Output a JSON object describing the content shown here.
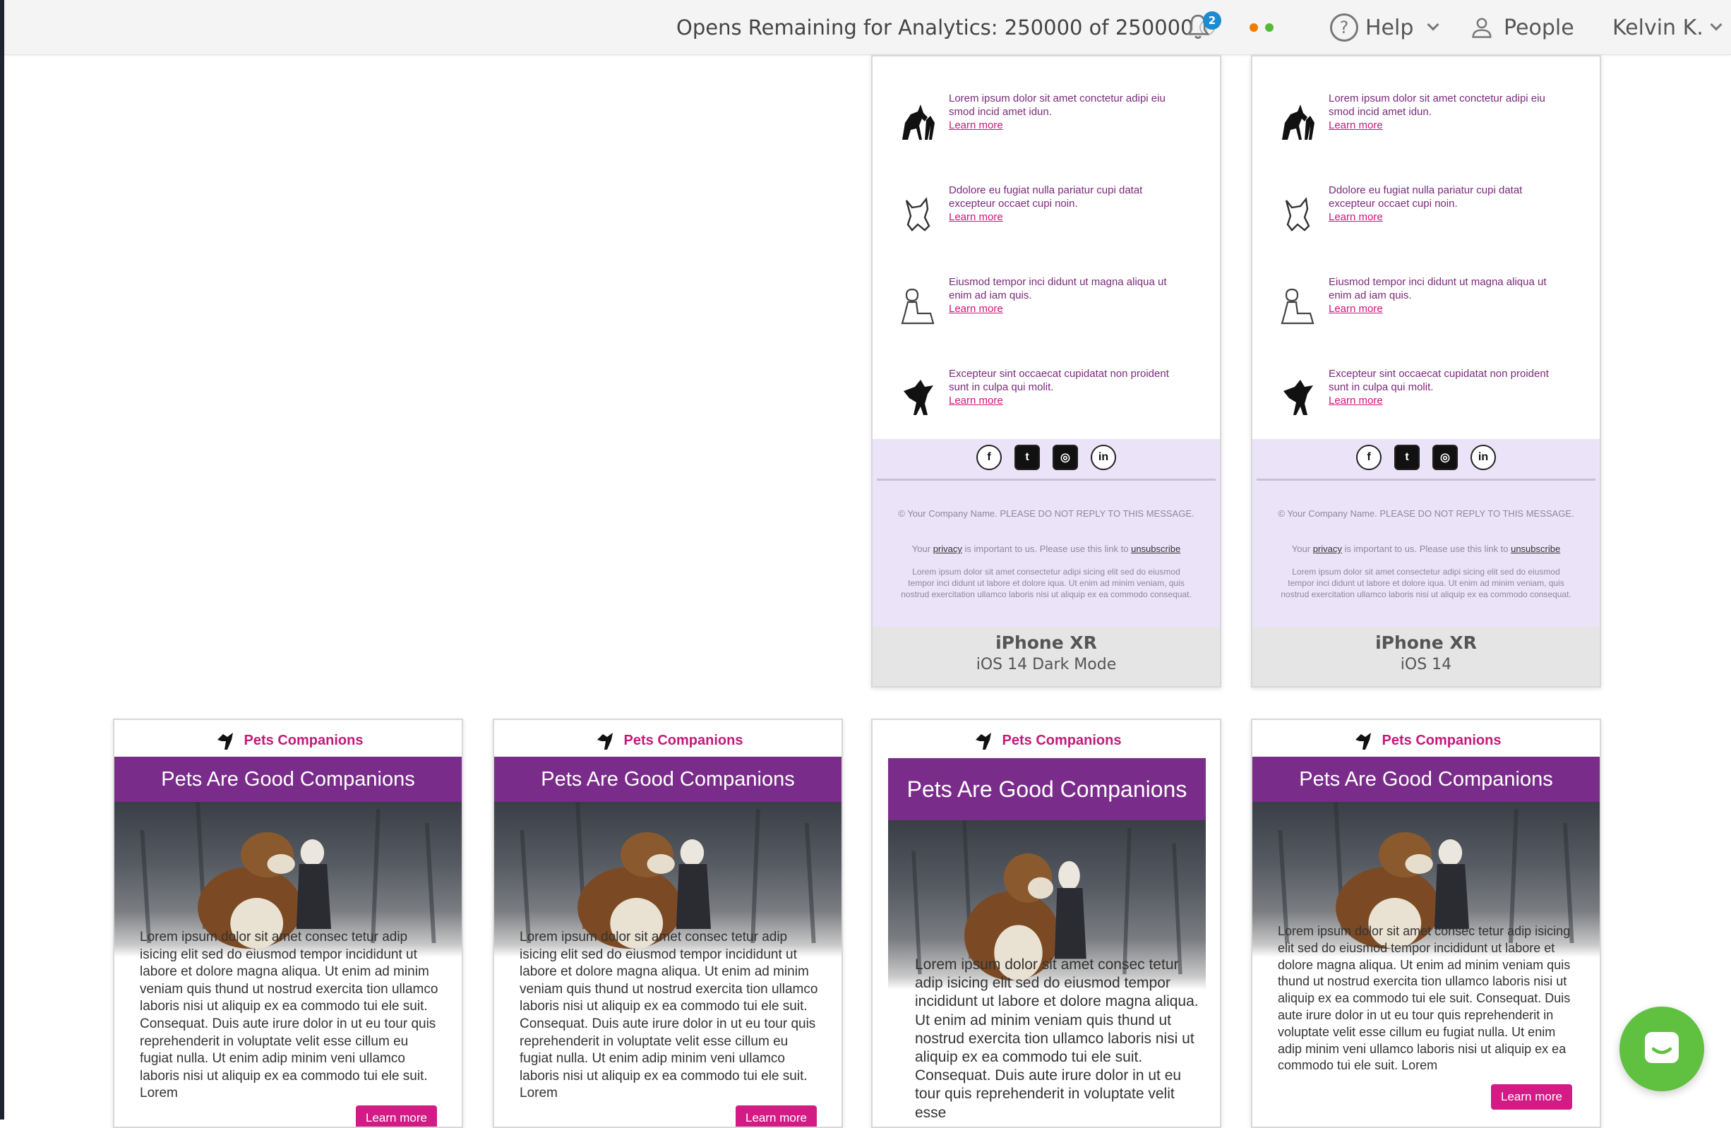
{
  "topbar": {
    "opens_text": "Opens Remaining for Analytics: 250000 of 250000",
    "notification_count": "2",
    "help_label": "Help",
    "people_label": "People",
    "user_label": "Kelvin K.",
    "status_dot_colors": [
      "#f07c00",
      "#55b83a"
    ]
  },
  "top_cards": [
    {
      "features": [
        {
          "icon": "horse-rider-icon",
          "text": "Lorem ipsum dolor sit amet conctetur adipi eiu smod incid amet idun.",
          "link": "Learn more"
        },
        {
          "icon": "cat-icon",
          "text": "Ddolore eu fugiat nulla pariatur cupi datat excepteur occaet cupi noin.",
          "link": "Learn more"
        },
        {
          "icon": "person-dog-icon",
          "text": "Eiusmod tempor inci didunt ut magna aliqua ut enim ad iam quis.",
          "link": "Learn more"
        },
        {
          "icon": "bird-icon",
          "text": "Excepteur sint occaecat cupidatat non proident sunt in culpa qui molit.",
          "link": "Learn more"
        }
      ],
      "copyright": "© Your Company Name. PLEASE DO NOT REPLY TO THIS MESSAGE.",
      "privacy_prefix": "Your",
      "privacy_link": "privacy",
      "privacy_middle": "is important to us. Please use this link to",
      "unsubscribe_link": "unsubscribe",
      "fine_print": "Lorem ipsum dolor sit amet consectetur adipi sicing elit sed do eiusmod tempor inci didunt ut labore et dolore iqua. Ut enim ad minim veniam, quis nostrud exercitation ullamco laboris nisi ut aliquip ex ea commodo consequat.",
      "device": "iPhone XR",
      "os": "iOS 14 Dark Mode"
    },
    {
      "features": [
        {
          "icon": "horse-rider-icon",
          "text": "Lorem ipsum dolor sit amet conctetur adipi eiu smod incid amet idun.",
          "link": "Learn more"
        },
        {
          "icon": "cat-icon",
          "text": "Ddolore eu fugiat nulla pariatur cupi datat excepteur occaet cupi noin.",
          "link": "Learn more"
        },
        {
          "icon": "person-dog-icon",
          "text": "Eiusmod tempor inci didunt ut magna aliqua ut enim ad iam quis.",
          "link": "Learn more"
        },
        {
          "icon": "bird-icon",
          "text": "Excepteur sint occaecat cupidatat non proident sunt in culpa qui molit.",
          "link": "Learn more"
        }
      ],
      "copyright": "© Your Company Name. PLEASE DO NOT REPLY TO THIS MESSAGE.",
      "privacy_prefix": "Your",
      "privacy_link": "privacy",
      "privacy_middle": "is important to us. Please use this link to",
      "unsubscribe_link": "unsubscribe",
      "fine_print": "Lorem ipsum dolor sit amet consectetur adipi sicing elit sed do eiusmod tempor inci didunt ut labore et dolore iqua. Ut enim ad minim veniam, quis nostrud exercitation ullamco laboris nisi ut aliquip ex ea commodo consequat.",
      "device": "iPhone XR",
      "os": "iOS 14"
    }
  ],
  "bottom_cards": [
    {
      "brand": "Pets Companions",
      "banner": "Pets Are Good Companions",
      "body": "Lorem ipsum dolor sit amet consec tetur adip isicing elit sed do eiusmod tempor incididunt ut labore et dolore magna aliqua. Ut enim ad minim veniam quis thund ut nostrud exercita tion ullamco laboris nisi ut aliquip ex ea commodo tui ele suit. Consequat. Duis aute irure dolor in ut eu tour quis reprehenderit in voluptate velit esse cillum eu fugiat nulla. Ut enim adip minim veni ullamco laboris nisi ut aliquip ex ea commodo tui ele suit. Lorem",
      "button": "Learn more"
    },
    {
      "brand": "Pets Companions",
      "banner": "Pets Are Good Companions",
      "body": "Lorem ipsum dolor sit amet consec tetur adip isicing elit sed do eiusmod tempor incididunt ut labore et dolore magna aliqua. Ut enim ad minim veniam quis thund ut nostrud exercita tion ullamco laboris nisi ut aliquip ex ea commodo tui ele suit. Consequat. Duis aute irure dolor in ut eu tour quis reprehenderit in voluptate velit esse cillum eu fugiat nulla. Ut enim adip minim veni ullamco laboris nisi ut aliquip ex ea commodo tui ele suit. Lorem",
      "button": "Learn more"
    },
    {
      "brand": "Pets Companions",
      "banner": "Pets Are Good Companions",
      "body": "Lorem ipsum dolor sit amet consec tetur adip isicing elit sed do eiusmod tempor incididunt ut labore et dolore magna aliqua. Ut enim ad minim veniam quis thund ut nostrud exercita tion ullamco laboris nisi ut aliquip ex ea commodo tui ele suit. Consequat. Duis aute irure dolor in ut eu tour quis reprehenderit in voluptate velit esse"
    },
    {
      "brand": "Pets Companions",
      "banner": "Pets Are Good Companions",
      "body": "Lorem ipsum dolor sit amet consec tetur adip isicing elit sed do eiusmod tempor incididunt ut labore et dolore magna aliqua. Ut enim ad minim veniam quis thund ut nostrud exercita tion ullamco laboris nisi ut aliquip ex ea commodo tui ele suit. Consequat. Duis aute irure dolor in ut eu tour quis reprehenderit in voluptate velit esse cillum eu fugiat nulla. Ut enim adip minim veni ullamco laboris nisi ut aliquip ex ea commodo tui ele suit. Lorem",
      "button": "Learn more"
    }
  ],
  "colors": {
    "brand_magenta": "#c4197a",
    "banner_purple": "#7a2c8a",
    "footer_lavender": "#ebe3f7",
    "chat_green": "#5fc13f",
    "badge_blue": "#1d8bd1"
  },
  "chat_widget": {
    "icon": "chat-icon"
  }
}
